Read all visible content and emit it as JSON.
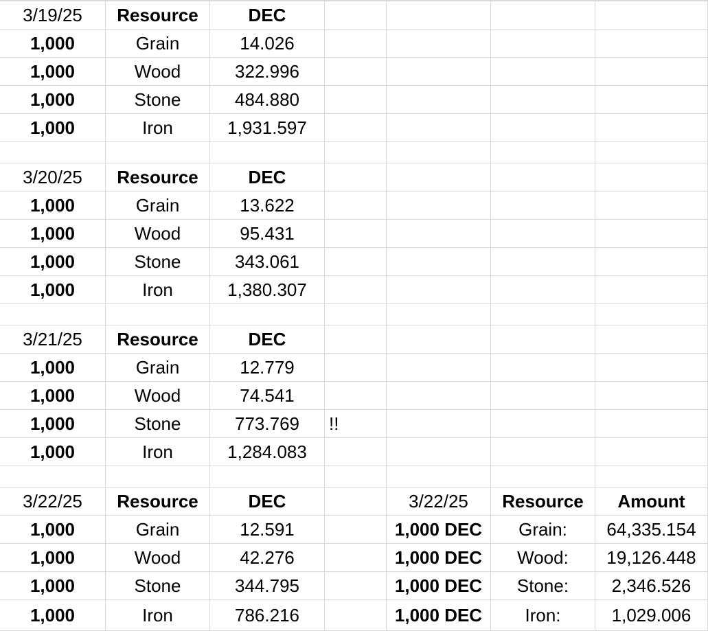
{
  "blocks": [
    {
      "date": "3/19/25",
      "header_resource": "Resource",
      "header_dec": "DEC",
      "rows": [
        {
          "qty": "1,000",
          "resource": "Grain",
          "dec": "14.026",
          "note": ""
        },
        {
          "qty": "1,000",
          "resource": "Wood",
          "dec": "322.996",
          "note": ""
        },
        {
          "qty": "1,000",
          "resource": "Stone",
          "dec": "484.880",
          "note": ""
        },
        {
          "qty": "1,000",
          "resource": "Iron",
          "dec": "1,931.597",
          "note": ""
        }
      ]
    },
    {
      "date": "3/20/25",
      "header_resource": "Resource",
      "header_dec": "DEC",
      "rows": [
        {
          "qty": "1,000",
          "resource": "Grain",
          "dec": "13.622",
          "note": ""
        },
        {
          "qty": "1,000",
          "resource": "Wood",
          "dec": "95.431",
          "note": ""
        },
        {
          "qty": "1,000",
          "resource": "Stone",
          "dec": "343.061",
          "note": ""
        },
        {
          "qty": "1,000",
          "resource": "Iron",
          "dec": "1,380.307",
          "note": ""
        }
      ]
    },
    {
      "date": "3/21/25",
      "header_resource": "Resource",
      "header_dec": "DEC",
      "rows": [
        {
          "qty": "1,000",
          "resource": "Grain",
          "dec": "12.779",
          "note": ""
        },
        {
          "qty": "1,000",
          "resource": "Wood",
          "dec": "74.541",
          "note": ""
        },
        {
          "qty": "1,000",
          "resource": "Stone",
          "dec": "773.769",
          "note": "!!"
        },
        {
          "qty": "1,000",
          "resource": "Iron",
          "dec": "1,284.083",
          "note": ""
        }
      ]
    },
    {
      "date": "3/22/25",
      "header_resource": "Resource",
      "header_dec": "DEC",
      "rows": [
        {
          "qty": "1,000",
          "resource": "Grain",
          "dec": "12.591",
          "note": ""
        },
        {
          "qty": "1,000",
          "resource": "Wood",
          "dec": "42.276",
          "note": ""
        },
        {
          "qty": "1,000",
          "resource": "Stone",
          "dec": "344.795",
          "note": ""
        },
        {
          "qty": "1,000",
          "resource": "Iron",
          "dec": "786.216",
          "note": ""
        }
      ]
    }
  ],
  "side_table": {
    "date": "3/22/25",
    "header_resource": "Resource",
    "header_amount": "Amount",
    "rows": [
      {
        "dec": "1,000 DEC",
        "resource": "Grain:",
        "amount": "64,335.154"
      },
      {
        "dec": "1,000 DEC",
        "resource": "Wood:",
        "amount": "19,126.448"
      },
      {
        "dec": "1,000 DEC",
        "resource": "Stone:",
        "amount": "2,346.526"
      },
      {
        "dec": "1,000 DEC",
        "resource": "Iron:",
        "amount": "1,029.006"
      }
    ]
  }
}
